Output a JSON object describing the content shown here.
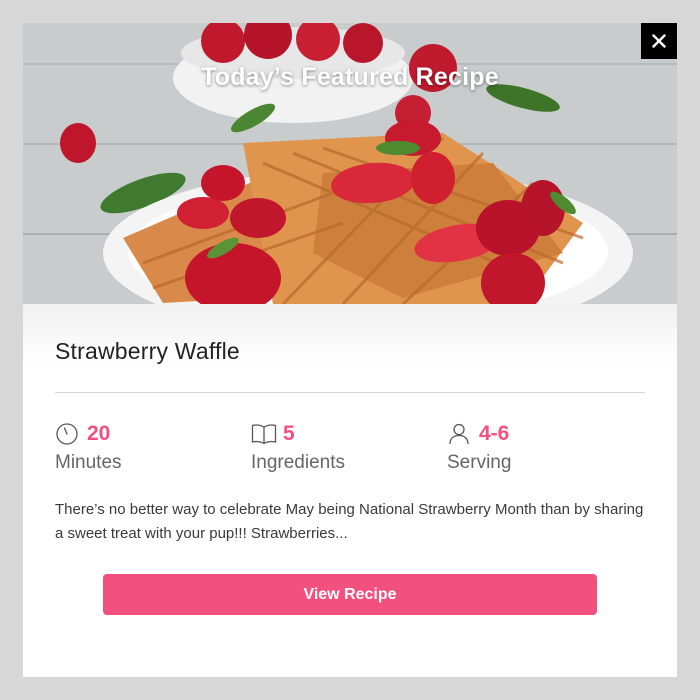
{
  "hero": {
    "title": "Today’s Featured Recipe",
    "close_icon": "close-icon"
  },
  "recipe": {
    "name": "Strawberry Waffle",
    "stats": [
      {
        "icon": "clock-icon",
        "value": "20",
        "label": "Minutes"
      },
      {
        "icon": "book-icon",
        "value": "5",
        "label": "Ingredients"
      },
      {
        "icon": "person-icon",
        "value": "4-6",
        "label": "Serving"
      }
    ],
    "description": "There’s no better way to celebrate May being National Strawberry Month than by sharing a sweet treat with your pup!!! Strawberries...",
    "cta_label": "View Recipe"
  },
  "colors": {
    "accent": "#f2507e",
    "overlay": "#d7d7d7",
    "close_bg": "#000000"
  }
}
